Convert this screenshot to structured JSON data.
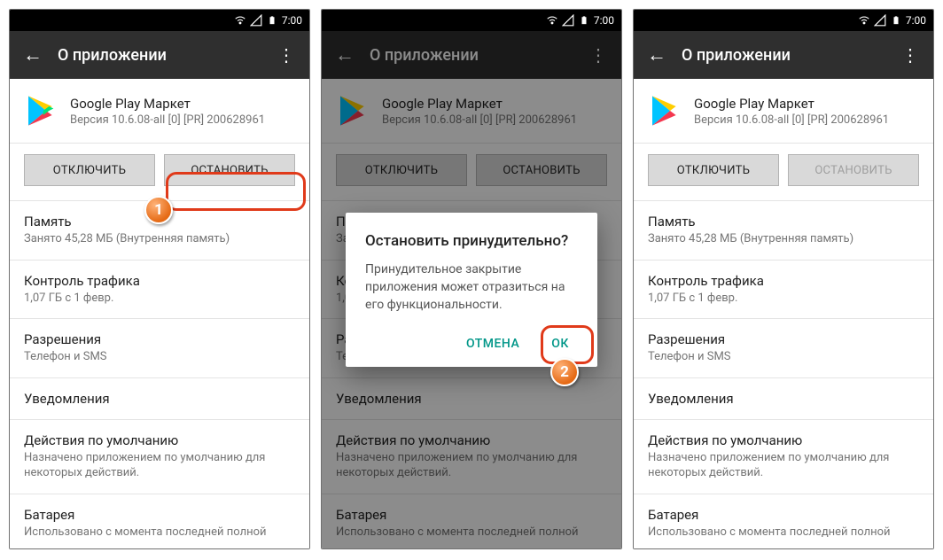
{
  "status": {
    "time": "7:00"
  },
  "header": {
    "title": "О приложении"
  },
  "app": {
    "name": "Google Play Маркет",
    "version": "Версия 10.6.08-all [0] [PR] 200628961"
  },
  "buttons": {
    "disable": "ОТКЛЮЧИТЬ",
    "stop": "ОСТАНОВИТЬ"
  },
  "rows": {
    "memory_t": "Память",
    "memory_s": "Занято 45,28  МБ (Внутренняя память)",
    "traffic_t": "Контроль трафика",
    "traffic_s": "1,07  ГБ с 1 февр.",
    "perms_t": "Разрешения",
    "perms_s": "Телефон и SMS",
    "notif_t": "Уведомления",
    "defaults_t": "Действия по умолчанию",
    "defaults_s": "Назначено приложением по умолчанию для некоторых действий.",
    "battery_t": "Батарея",
    "battery_s": "Использовано с момента последней полной"
  },
  "dialog": {
    "title": "Остановить принудительно?",
    "msg": "Принудительное закрытие приложения может отразиться на его функциональности.",
    "cancel": "ОТМЕНА",
    "ok": "ОК"
  },
  "markers": {
    "one": "1",
    "two": "2"
  }
}
